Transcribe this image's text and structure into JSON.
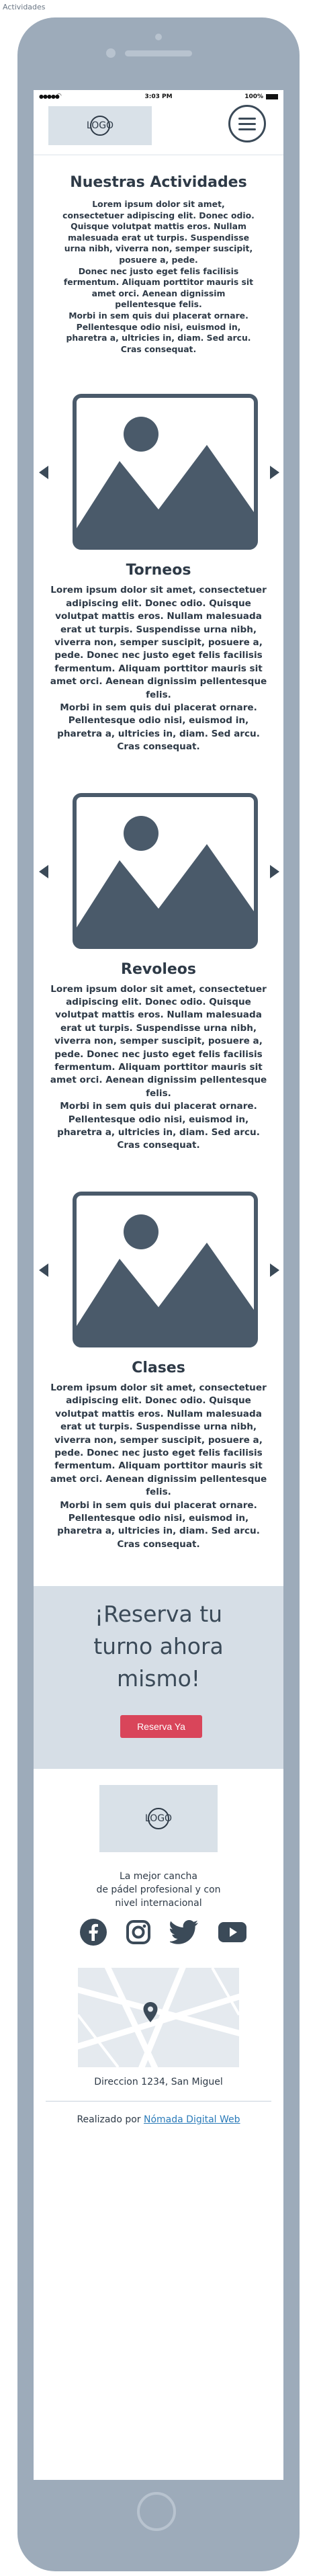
{
  "page_label": "Actividades",
  "status_bar": {
    "time": "3:03 PM",
    "battery": "100%"
  },
  "header": {
    "logo_text": "LOGO"
  },
  "intro": {
    "title": "Nuestras Actividades",
    "text": "Lorem ipsum dolor sit amet, consectetuer adipiscing elit. Donec odio. Quisque volutpat mattis eros. Nullam malesuada erat ut turpis. Suspendisse urna nibh, viverra non, semper suscipit, posuere a, pede.\nDonec nec justo eget felis facilisis fermentum. Aliquam porttitor mauris sit amet orci. Aenean dignissim pellentesque felis.\nMorbi in sem quis dui placerat ornare. Pellentesque odio nisi, euismod in, pharetra a, ultricies in, diam. Sed arcu. Cras consequat."
  },
  "activities": [
    {
      "title": "Torneos",
      "text": "Lorem ipsum dolor sit amet, consectetuer adipiscing elit. Donec odio. Quisque volutpat mattis eros. Nullam malesuada erat ut turpis. Suspendisse urna nibh, viverra non, semper suscipit, posuere a, pede. Donec nec justo eget felis facilisis fermentum. Aliquam porttitor mauris sit amet orci. Aenean dignissim pellentesque felis.\nMorbi in sem quis dui placerat ornare. Pellentesque odio nisi, euismod in, pharetra a, ultricies in, diam. Sed arcu. Cras consequat."
    },
    {
      "title": "Revoleos",
      "text": "Lorem ipsum dolor sit amet, consectetuer adipiscing elit. Donec odio. Quisque volutpat mattis eros. Nullam malesuada erat ut turpis. Suspendisse urna nibh, viverra non, semper suscipit, posuere a, pede. Donec nec justo eget felis facilisis fermentum. Aliquam porttitor mauris sit amet orci. Aenean dignissim pellentesque felis.\nMorbi in sem quis dui placerat ornare. Pellentesque odio nisi, euismod in, pharetra a, ultricies in, diam. Sed arcu. Cras consequat."
    },
    {
      "title": "Clases",
      "text": "Lorem ipsum dolor sit amet, consectetuer adipiscing elit. Donec odio. Quisque volutpat mattis eros. Nullam malesuada erat ut turpis. Suspendisse urna nibh, viverra non, semper suscipit, posuere a, pede. Donec nec justo eget felis facilisis fermentum. Aliquam porttitor mauris sit amet orci. Aenean dignissim pellentesque felis.\nMorbi in sem quis dui placerat ornare. Pellentesque odio nisi, euismod in, pharetra a, ultricies in, diam. Sed arcu. Cras consequat."
    }
  ],
  "cta": {
    "text": "¡Reserva tu\nturno ahora\nmismo!",
    "button": "Reserva Ya"
  },
  "footer": {
    "logo_text": "LOGO",
    "tagline": "La mejor cancha\nde pádel profesional y con\nnivel internacional",
    "address": "Direccion 1234, San Miguel",
    "credit_prefix": "Realizado por",
    "credit_link": "Nómada Digital Web",
    "socials": [
      "facebook-icon",
      "instagram-icon",
      "twitter-icon",
      "youtube-icon"
    ]
  },
  "colors": {
    "accent": "#d9455a",
    "device_frame": "#9dabba",
    "placeholder": "#4a5a6a",
    "link": "#2b7bb9"
  }
}
